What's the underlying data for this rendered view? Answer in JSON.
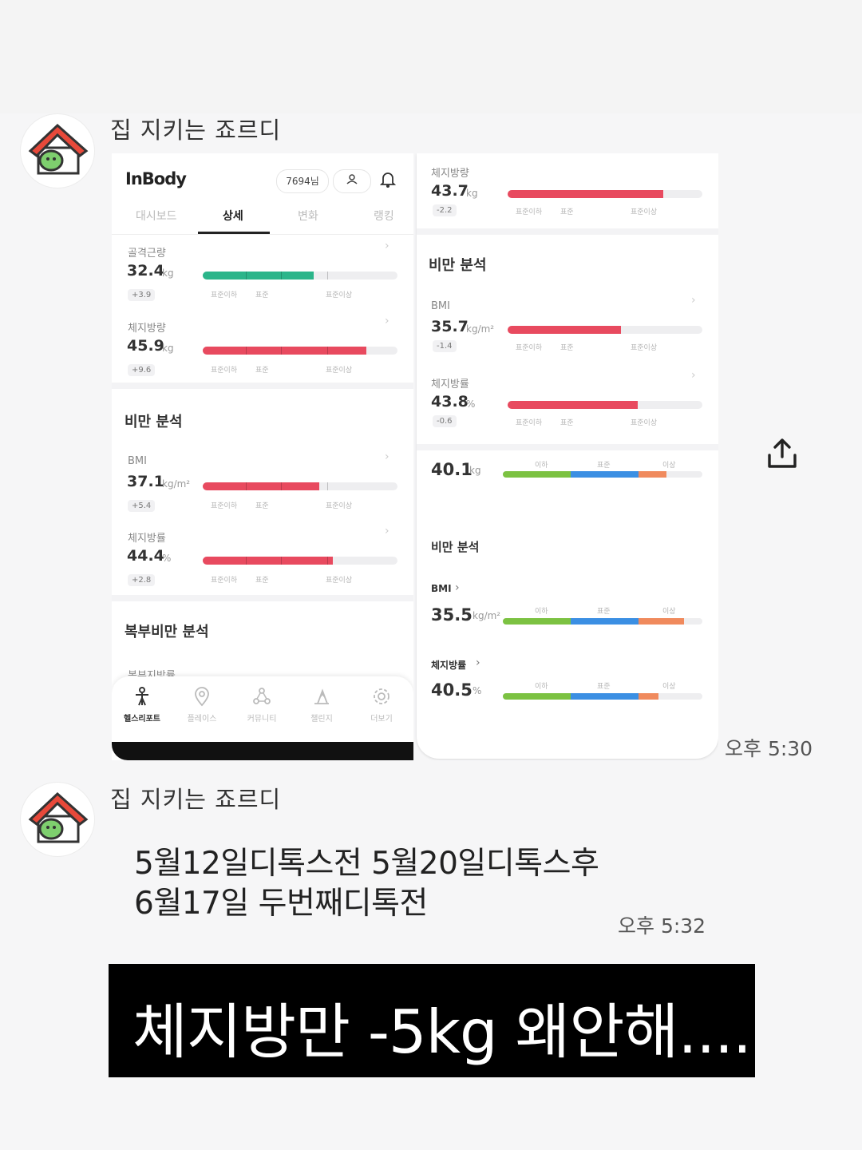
{
  "messages": [
    {
      "sender": "집 지키는 죠르디",
      "time": "오후 5:30"
    },
    {
      "sender": "집 지키는 죠르디",
      "time": "오후 5:32",
      "lines": [
        "5월12일디톡스전 5월20일디톡스후",
        "6월17일 두번째디톡전"
      ]
    }
  ],
  "caption": "체지방만 -5kg 왜안해....",
  "colors": {
    "red": "#e84a5f",
    "green": "#2bb58a",
    "lime": "#7cc242",
    "blue": "#3b8fe3",
    "orange": "#f08a5d"
  },
  "left_screen": {
    "logo": "InBody",
    "user_chip": "7694님",
    "tabs": [
      "대시보드",
      "상세",
      "변화",
      "랭킹"
    ],
    "active_tab": "상세",
    "range_labels": [
      "표준이하",
      "표준",
      "표준이상"
    ],
    "metrics": [
      {
        "label": "골격근량",
        "value": "32.4",
        "unit": "kg",
        "change": "+3.9",
        "level": 0.57,
        "color": "green"
      },
      {
        "label": "체지방량",
        "value": "45.9",
        "unit": "kg",
        "change": "+9.6",
        "level": 0.84,
        "color": "red"
      },
      {
        "label": "BMI",
        "value": "37.1",
        "unit": "kg/m²",
        "change": "+5.4",
        "level": 0.6,
        "color": "red"
      },
      {
        "label": "체지방률",
        "value": "44.4",
        "unit": "%",
        "change": "+2.8",
        "level": 0.67,
        "color": "red"
      }
    ],
    "sections": [
      "비만 분석",
      "복부비만 분석"
    ],
    "abdominal_label": "복부지방률",
    "bottom_nav": [
      "헬스리포트",
      "플레이스",
      "커뮤니티",
      "챌린지",
      "더보기"
    ],
    "bottom_nav_icons": [
      "person-icon",
      "map-pin-icon",
      "community-icon",
      "flag-icon",
      "settings-icon"
    ]
  },
  "right_screen": {
    "range_labels": [
      "표준이하",
      "표준",
      "표준이상"
    ],
    "top_metric": {
      "label": "체지방량",
      "value": "43.7",
      "unit": "kg",
      "change": "-2.2",
      "level": 0.8
    },
    "section_title": "비만 분석",
    "metrics": [
      {
        "label": "BMI",
        "value": "35.7",
        "unit": "kg/m²",
        "change": "-1.4",
        "level": 0.58
      },
      {
        "label": "체지방률",
        "value": "43.8",
        "unit": "%",
        "change": "-0.6",
        "level": 0.67
      }
    ],
    "alt_labels": [
      "이하",
      "표준",
      "이상"
    ],
    "alt_weight": {
      "value": "40.1",
      "unit": "kg",
      "levels": [
        0.34,
        0.68,
        0.82
      ]
    },
    "alt_section_title": "비만 분석",
    "alt_metrics": [
      {
        "label": "BMI",
        "value": "35.5",
        "unit": "kg/m²",
        "levels": [
          0.34,
          0.68,
          0.91
        ]
      },
      {
        "label": "체지방률",
        "value": "40.5",
        "unit": "%",
        "levels": [
          0.34,
          0.68,
          0.78
        ]
      }
    ]
  }
}
